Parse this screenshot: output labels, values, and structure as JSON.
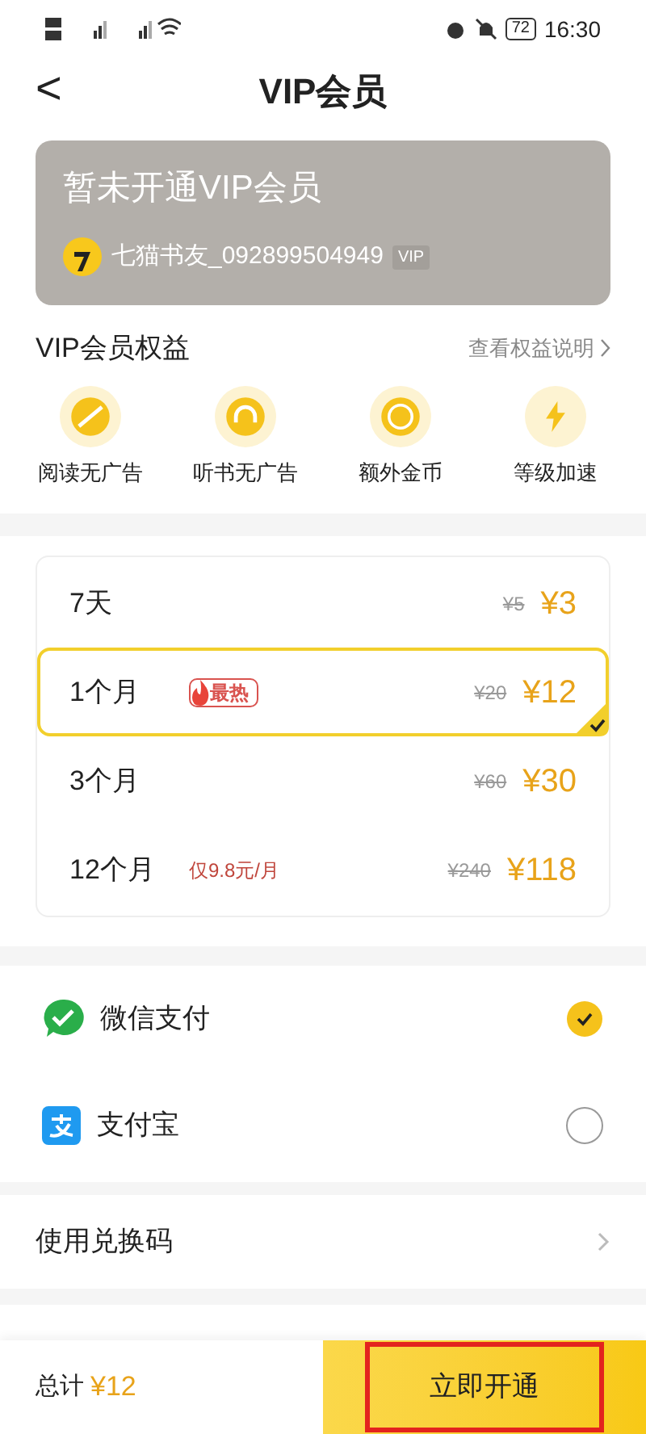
{
  "status_bar": {
    "battery": "72",
    "time": "16:30"
  },
  "header": {
    "back": "<",
    "title": "VIP会员"
  },
  "member_card": {
    "status": "暂未开通VIP会员",
    "username": "七猫书友_092899504949",
    "badge": "VIP"
  },
  "benefits": {
    "title": "VIP会员权益",
    "link": "查看权益说明",
    "items": [
      {
        "kind": "noad",
        "label": "阅读无广告"
      },
      {
        "kind": "listen",
        "label": "听书无广告"
      },
      {
        "kind": "coin",
        "label": "额外金币"
      },
      {
        "kind": "boost",
        "label": "等级加速"
      }
    ]
  },
  "plans": [
    {
      "name": "7天",
      "original": "¥5",
      "price": "¥3",
      "selected": false
    },
    {
      "name": "1个月",
      "tag": "最热",
      "original": "¥20",
      "price": "¥12",
      "selected": true
    },
    {
      "name": "3个月",
      "original": "¥60",
      "price": "¥30",
      "selected": false
    },
    {
      "name": "12个月",
      "note": "仅9.8元/月",
      "original": "¥240",
      "price": "¥118",
      "selected": false
    }
  ],
  "payment_methods": [
    {
      "kind": "wechat",
      "label": "微信支付",
      "selected": true
    },
    {
      "kind": "alipay",
      "label": "支付宝",
      "selected": false
    }
  ],
  "redeem": {
    "label": "使用兑换码"
  },
  "footer": {
    "total_label": "总计",
    "total": "¥12",
    "button": "立即开通"
  }
}
